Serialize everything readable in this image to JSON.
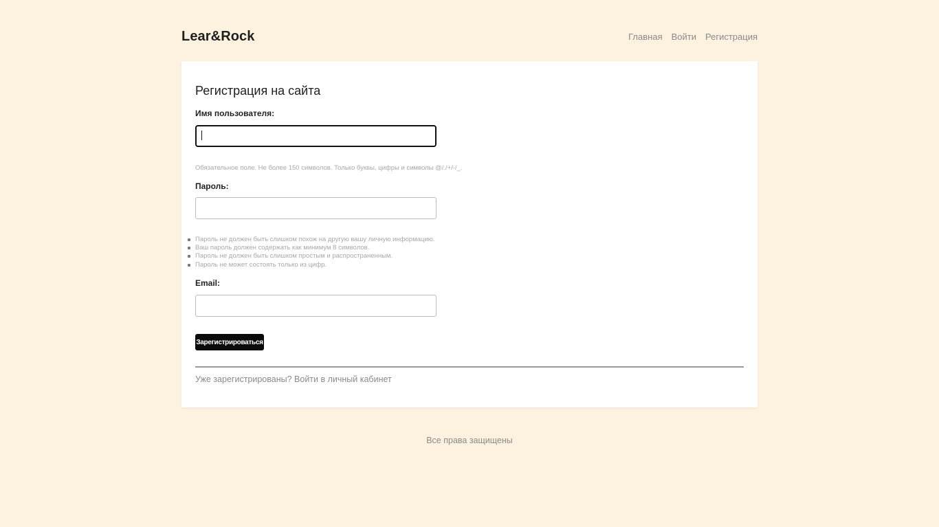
{
  "header": {
    "logo": "Lear&Rock",
    "nav": {
      "home": "Главная",
      "login": "Войти",
      "register": "Регистрация"
    }
  },
  "form": {
    "title": "Регистрация на сайта",
    "username": {
      "label": "Имя пользователя:",
      "value": "",
      "help": "Обязательное поле. Не более 150 символов. Только буквы, цифры и символы @/./+/-/_."
    },
    "password": {
      "label": "Пароль:",
      "value": "",
      "rules": [
        "Пароль не должен быть слишком похож на другую вашу личную информацию.",
        "Ваш пароль должен содержать как минимум 8 символов.",
        "Пароль не должен быть слишком простым и распространенным.",
        "Пароль не может состоять только из цифр."
      ]
    },
    "email": {
      "label": "Email:",
      "value": ""
    },
    "submit_label": "Зарегистрироваться",
    "already_text": "Уже зарегистрированы?",
    "login_link": "Войти в личный кабинет"
  },
  "footer": {
    "text": "Все права защищены"
  },
  "colors": {
    "background": "#fdf2e0",
    "card": "#ffffff",
    "button": "#0a0a0a",
    "muted_text": "#8a8a8a"
  }
}
